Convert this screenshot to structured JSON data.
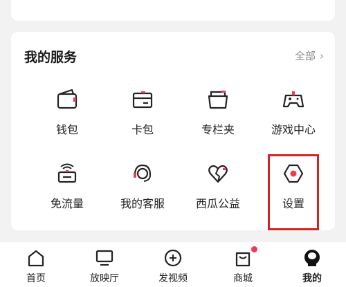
{
  "services": {
    "title": "我的服务",
    "more_label": "全部",
    "items": [
      {
        "label": "钱包",
        "icon": "wallet-icon"
      },
      {
        "label": "卡包",
        "icon": "card-holder-icon"
      },
      {
        "label": "专栏夹",
        "icon": "column-folder-icon"
      },
      {
        "label": "游戏中心",
        "icon": "gamepad-icon"
      },
      {
        "label": "免流量",
        "icon": "free-data-icon"
      },
      {
        "label": "我的客服",
        "icon": "headset-icon"
      },
      {
        "label": "西瓜公益",
        "icon": "charity-heart-icon"
      },
      {
        "label": "设置",
        "icon": "settings-hexagon-icon"
      }
    ]
  },
  "bottom_nav": {
    "items": [
      {
        "label": "首页",
        "icon": "home-icon"
      },
      {
        "label": "放映厅",
        "icon": "screen-icon"
      },
      {
        "label": "发视频",
        "icon": "add-video-icon"
      },
      {
        "label": "商城",
        "icon": "shopping-bag-icon"
      },
      {
        "label": "我的",
        "icon": "profile-icon"
      }
    ]
  },
  "colors": {
    "accent": "#ee3a55",
    "highlight_border": "#d32323",
    "background": "#f2f2f2",
    "card": "#ffffff"
  }
}
